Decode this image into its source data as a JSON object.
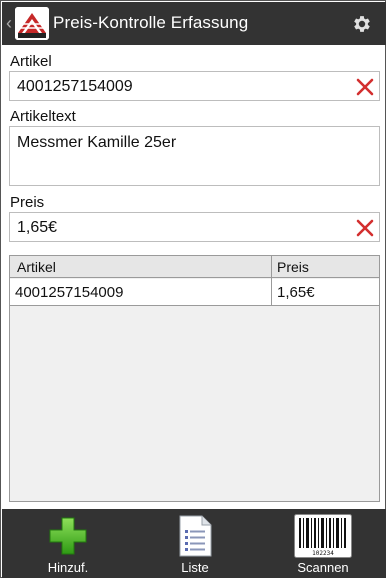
{
  "header": {
    "title": "Preis-Kontrolle Erfassung"
  },
  "form": {
    "artikel_label": "Artikel",
    "artikel_value": "4001257154009",
    "artikeltext_label": "Artikeltext",
    "artikeltext_value": "Messmer Kamille 25er",
    "preis_label": "Preis",
    "preis_value": "1,65€"
  },
  "table": {
    "columns": [
      "Artikel",
      "Preis"
    ],
    "rows": [
      [
        "4001257154009",
        "1,65€"
      ]
    ]
  },
  "toolbar": {
    "add_label": "Hinzuf.",
    "list_label": "Liste",
    "scan_label": "Scannen",
    "barcode_number": "102234"
  },
  "colors": {
    "bar": "#333333",
    "clear_x": "#d32f2f",
    "add_green": "#4caf2a"
  }
}
